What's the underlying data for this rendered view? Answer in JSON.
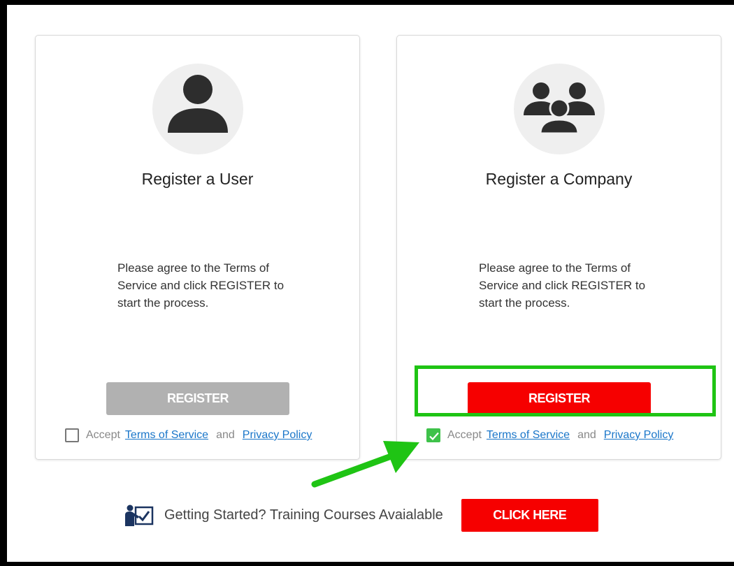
{
  "user_card": {
    "title": "Register a User",
    "description": "Please agree to the Terms of Service and click REGISTER to start the process.",
    "register_label": "REGISTER",
    "register_enabled": false,
    "accept_checked": false,
    "accept_prefix": "Accept",
    "terms_link": "Terms of Service",
    "and_text": "and",
    "privacy_link": "Privacy Policy",
    "icon": "user-icon"
  },
  "company_card": {
    "title": "Register a Company",
    "description": "Please agree to the Terms of Service and click REGISTER to start the process.",
    "register_label": "REGISTER",
    "register_enabled": true,
    "accept_checked": true,
    "accept_prefix": "Accept",
    "terms_link": "Terms of Service",
    "and_text": "and",
    "privacy_link": "Privacy Policy",
    "icon": "group-icon"
  },
  "footer": {
    "text": "Getting Started? Training Courses Avaialable",
    "button_label": "CLICK HERE",
    "icon": "training-icon"
  },
  "colors": {
    "primary_red": "#f60000",
    "disabled_gray": "#b1b1b1",
    "highlight_green": "#1fc414",
    "check_green": "#3ec24a",
    "link_blue": "#1a76c9",
    "icon_dark": "#2d2d2d",
    "footer_icon_navy": "#1b3460"
  }
}
